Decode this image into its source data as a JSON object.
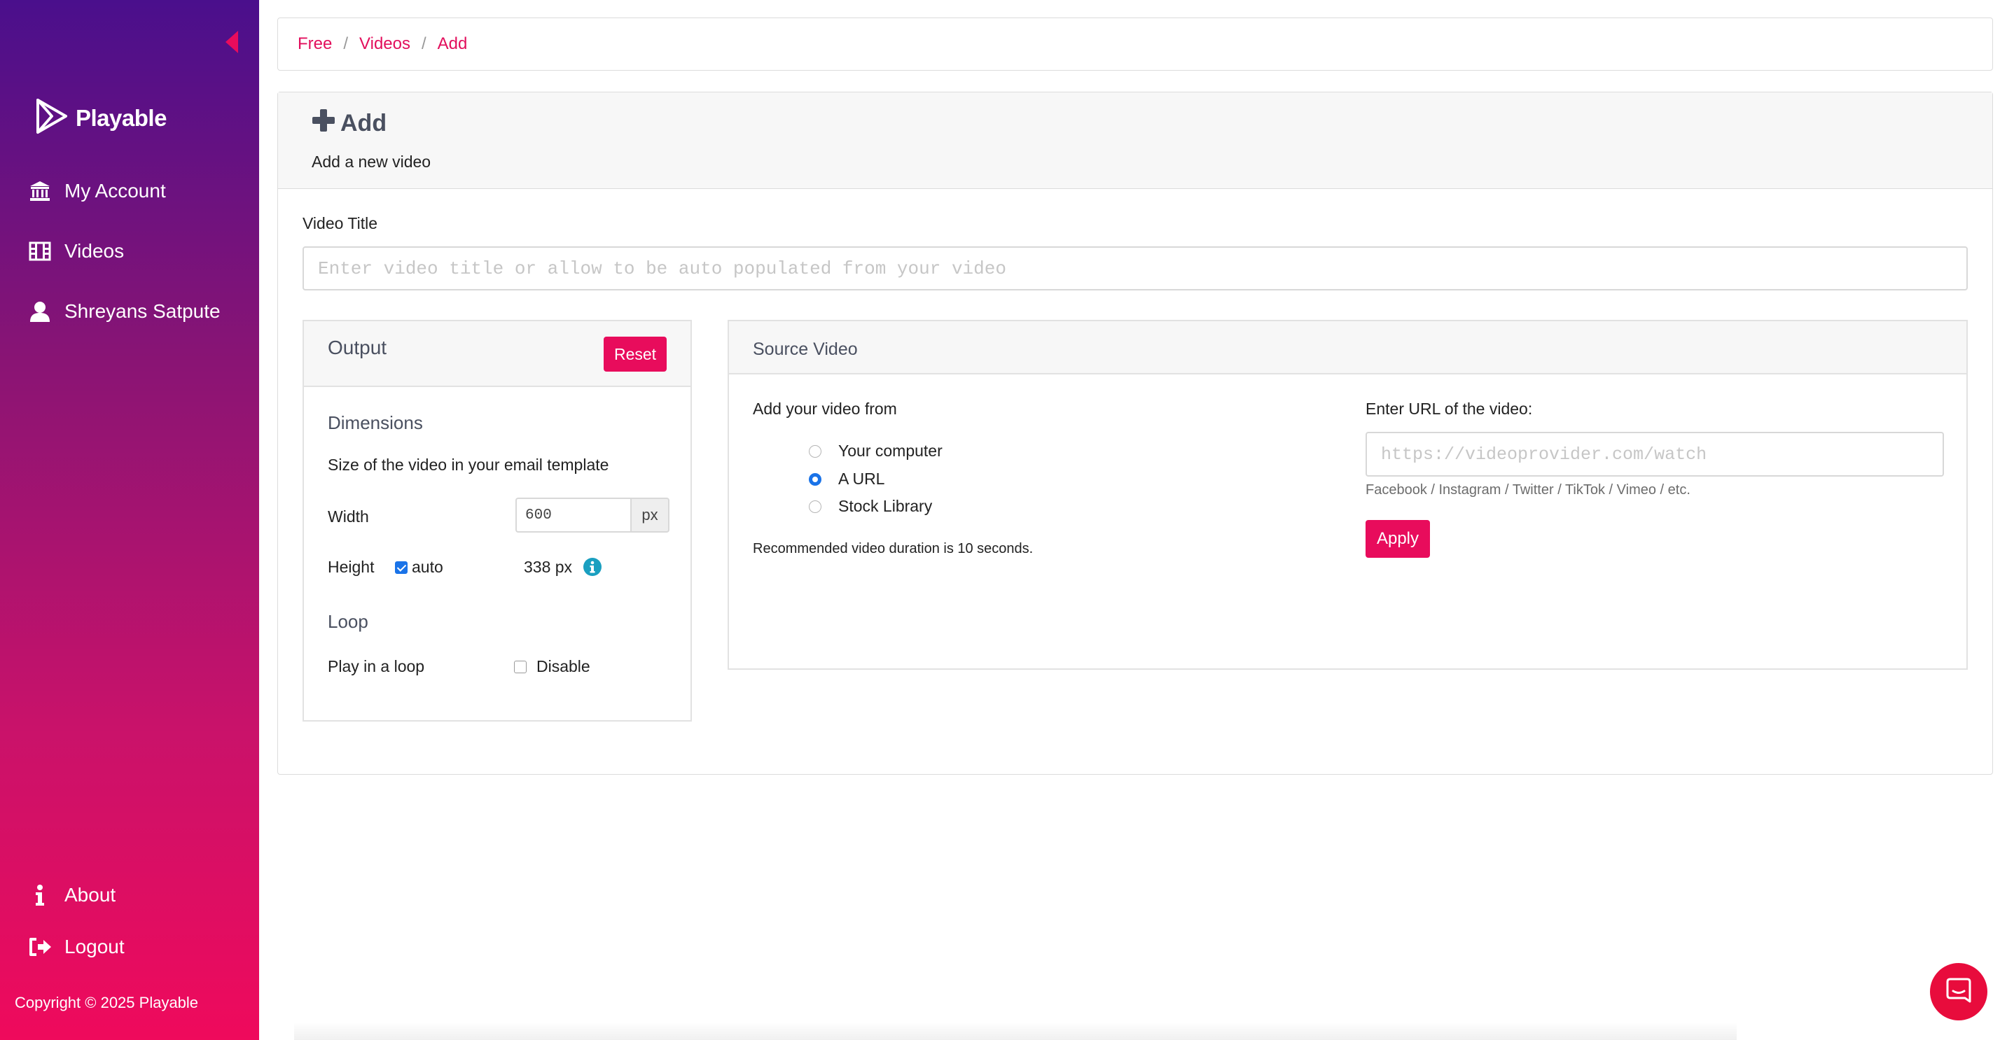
{
  "sidebar": {
    "logo_text": "Playable",
    "items": [
      {
        "label": "My Account",
        "icon": "bank-icon"
      },
      {
        "label": "Videos",
        "icon": "film-icon"
      },
      {
        "label": "Shreyans Satpute",
        "icon": "user-icon"
      }
    ],
    "bottom_items": [
      {
        "label": "About",
        "icon": "info-icon"
      },
      {
        "label": "Logout",
        "icon": "logout-icon"
      }
    ],
    "copyright": "Copyright © 2025 Playable"
  },
  "breadcrumb": {
    "items": [
      "Free",
      "Videos",
      "Add"
    ],
    "separator": "/"
  },
  "page": {
    "title": "Add",
    "subtitle": "Add a new video"
  },
  "form": {
    "title_label": "Video Title",
    "title_placeholder": "Enter video title or allow to be auto populated from your video",
    "title_value": ""
  },
  "output": {
    "title": "Output",
    "reset_label": "Reset",
    "dimensions_title": "Dimensions",
    "dimensions_desc": "Size of the video in your email template",
    "width_label": "Width",
    "width_value": "600",
    "width_unit": "px",
    "height_label": "Height",
    "height_auto_label": "auto",
    "height_auto_checked": true,
    "height_value": "338 px",
    "loop_title": "Loop",
    "loop_label": "Play in a loop",
    "loop_disable_label": "Disable",
    "loop_disable_checked": false
  },
  "source": {
    "title": "Source Video",
    "add_from_label": "Add your video from",
    "options": [
      {
        "label": "Your computer",
        "selected": false
      },
      {
        "label": "A URL",
        "selected": true
      },
      {
        "label": "Stock Library",
        "selected": false
      }
    ],
    "recommendation": "Recommended video duration is 10 seconds.",
    "url_label": "Enter URL of the video:",
    "url_placeholder": "https://videoprovider.com/watch",
    "url_value": "",
    "providers_hint": "Facebook / Instagram / Twitter / TikTok / Vimeo / etc.",
    "apply_label": "Apply"
  },
  "colors": {
    "accent": "#e80c5c",
    "sidebar_top": "#4a0f8c",
    "sidebar_bottom": "#ef0a5c",
    "radio_selected": "#1a73e8",
    "info": "#1a9fc0"
  }
}
